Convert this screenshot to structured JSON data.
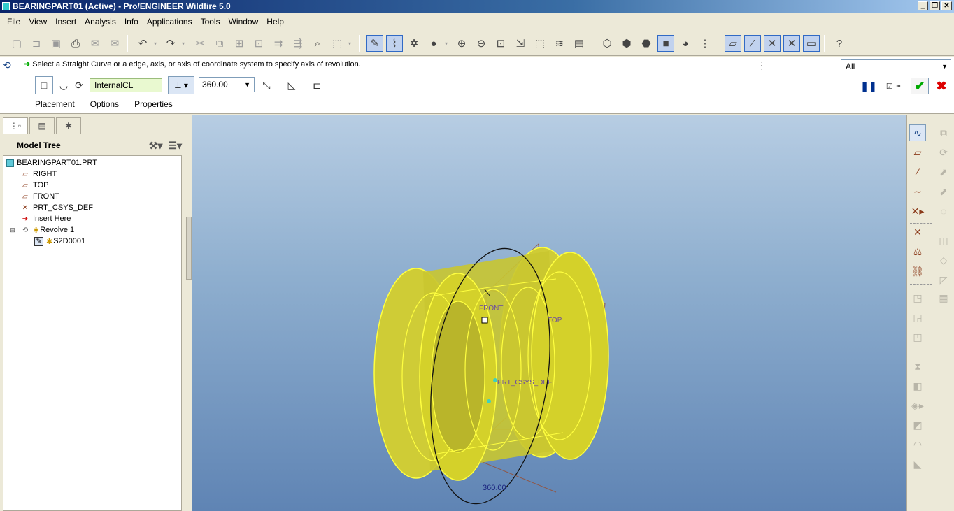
{
  "window": {
    "title": "BEARINGPART01 (Active) - Pro/ENGINEER Wildfire 5.0",
    "controls": [
      "_",
      "❐",
      "✕"
    ]
  },
  "menu": [
    "File",
    "View",
    "Insert",
    "Analysis",
    "Info",
    "Applications",
    "Tools",
    "Window",
    "Help"
  ],
  "dashboard": {
    "prompt": "Select a  Straight Curve or a edge, axis, or axis of coordinate system to specify axis of revolution.",
    "filter": "All",
    "reference": "InternalCL",
    "angle": "360.00",
    "slideup_tabs": [
      "Placement",
      "Options",
      "Properties"
    ]
  },
  "model_tree": {
    "title": "Model Tree",
    "items": [
      {
        "label": "BEARINGPART01.PRT",
        "icon": "part-icon"
      },
      {
        "label": "RIGHT",
        "icon": "datum-plane-icon"
      },
      {
        "label": "TOP",
        "icon": "datum-plane-icon"
      },
      {
        "label": "FRONT",
        "icon": "datum-plane-icon"
      },
      {
        "label": "PRT_CSYS_DEF",
        "icon": "csys-icon"
      },
      {
        "label": "Insert Here",
        "icon": "insert-arrow-icon"
      },
      {
        "label": "Revolve 1",
        "icon": "revolve-icon"
      },
      {
        "label": "S2D0001",
        "icon": "sketch-icon"
      }
    ]
  },
  "viewport": {
    "labels": {
      "front": "FRONT",
      "top": "TOP",
      "csys": "PRT_CSYS_DEF",
      "dimension": "360.00"
    }
  },
  "colors": {
    "accent": "#316ac5",
    "model_fill": "#d4d12a",
    "model_edge": "#ffff30",
    "ok": "#00aa00",
    "cancel": "#dd0000"
  }
}
